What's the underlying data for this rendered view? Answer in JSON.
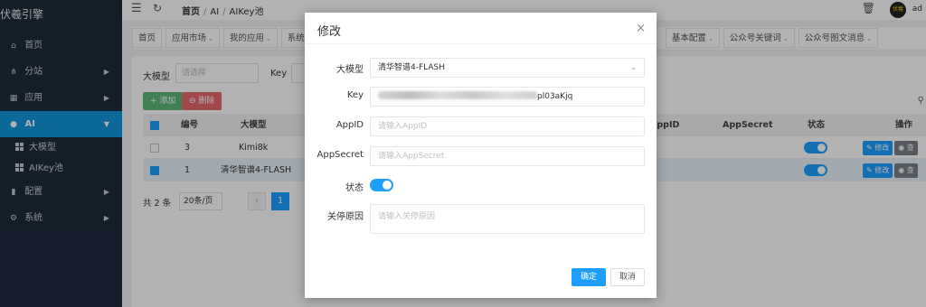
{
  "brand": "伏羲引擎",
  "sidebar": {
    "items": [
      {
        "icon": "home-icon",
        "glyph": "⌂",
        "label": "首页",
        "arrow": ""
      },
      {
        "icon": "share-icon",
        "glyph": "⋔",
        "label": "分站",
        "arrow": "▶"
      },
      {
        "icon": "grid-icon",
        "glyph": "▦",
        "label": "应用",
        "arrow": "▶"
      },
      {
        "icon": "bulb-icon",
        "glyph": "●",
        "label": "AI",
        "arrow": "▼"
      },
      {
        "icon": "bar-chart-icon",
        "glyph": "▮",
        "label": "配置",
        "arrow": "▶"
      },
      {
        "icon": "gear-icon",
        "glyph": "⚙",
        "label": "系统",
        "arrow": "▶"
      }
    ],
    "subitems": [
      "大模型",
      "AIKey池"
    ]
  },
  "topbar": {
    "breadcrumb": [
      "首页",
      "AI",
      "AIKey池"
    ],
    "avatar_text": "伏羲",
    "username": "ad"
  },
  "tabs": [
    {
      "label": "首页",
      "caret": ""
    },
    {
      "label": "应用市场",
      "caret": "⌄"
    },
    {
      "label": "我的应用",
      "caret": "⌄"
    },
    {
      "label": "系统",
      "caret": ""
    },
    {
      "label": "基本配置",
      "caret": "⌄"
    },
    {
      "label": "公众号关键词",
      "caret": "⌄"
    },
    {
      "label": "公众号图文消息",
      "caret": "⌄"
    }
  ],
  "filter": {
    "model_label": "大模型",
    "model_placeholder": "请选择",
    "key_label": "Key"
  },
  "toolbar": {
    "add_label": "+ 添加",
    "delete_label": "⊖ 删除"
  },
  "table": {
    "headers": {
      "id": "编号",
      "model": "大模型",
      "appid": "AppID",
      "appsecret": "AppSecret",
      "status": "状态",
      "ops": "操作"
    },
    "rows": [
      {
        "id": "3",
        "model": "Kimi8k",
        "checked": false
      },
      {
        "id": "1",
        "model": "清华智谱4-FLASH",
        "checked": true
      }
    ],
    "edit_label": "✎ 修改",
    "view_label": "◉ 查"
  },
  "pager": {
    "total": "共 2 条",
    "page_size": "20条/页",
    "prev": "‹",
    "current": "1"
  },
  "dialog": {
    "title": "修改",
    "close": "×",
    "fields": {
      "model_label": "大模型",
      "model_value": "清华智谱4-FLASH",
      "key_label": "Key",
      "key_visible_suffix": "pl03aKjq",
      "appid_label": "AppID",
      "appid_placeholder": "请输入AppID",
      "appsecret_label": "AppSecret",
      "appsecret_placeholder": "请输入AppSecret",
      "status_label": "状态",
      "reason_label": "关停原因",
      "reason_placeholder": "请输入关停原因"
    },
    "status_on": true,
    "confirm_label": "确定",
    "cancel_label": "取消"
  },
  "colors": {
    "sidebar_bg": "#1e2b3c",
    "sidebar_active": "#1296db",
    "primary": "#1e9fff",
    "add": "#5fb878",
    "delete": "#e8666b"
  }
}
